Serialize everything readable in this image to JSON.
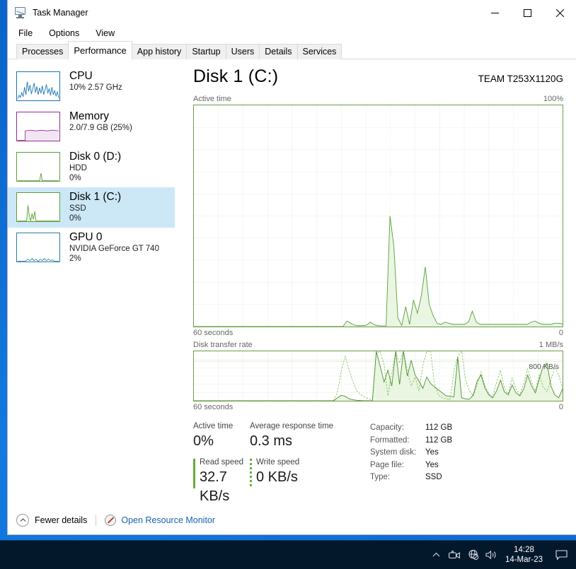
{
  "window": {
    "title": "Task Manager",
    "icon": "task-manager-icon",
    "controls": {
      "minimize": "─",
      "maximize": "□",
      "close": "✕"
    }
  },
  "menu": {
    "items": [
      "File",
      "Options",
      "View"
    ]
  },
  "tabs": {
    "items": [
      "Processes",
      "Performance",
      "App history",
      "Startup",
      "Users",
      "Details",
      "Services"
    ],
    "active": "Performance"
  },
  "sidebar": {
    "items": [
      {
        "title": "CPU",
        "sub1": "10%  2.57 GHz",
        "sub2": "",
        "color": "#1a74b0",
        "selected": false
      },
      {
        "title": "Memory",
        "sub1": "2.0/7.9 GB (25%)",
        "sub2": "",
        "color": "#8b2f8b",
        "selected": false
      },
      {
        "title": "Disk 0 (D:)",
        "sub1": "HDD",
        "sub2": "0%",
        "color": "#5a9e3a",
        "selected": false
      },
      {
        "title": "Disk 1 (C:)",
        "sub1": "SSD",
        "sub2": "0%",
        "color": "#5a9e3a",
        "selected": true
      },
      {
        "title": "GPU 0",
        "sub1": "NVIDIA GeForce GT 740",
        "sub2": "2%",
        "color": "#2a7f9e",
        "selected": false
      }
    ]
  },
  "main": {
    "title": "Disk 1 (C:)",
    "model": "TEAM T253X1120G",
    "active_graph": {
      "label": "Active time",
      "max_label": "100%",
      "x_label": "60 seconds",
      "min_label": "0"
    },
    "transfer_graph": {
      "label": "Disk transfer rate",
      "max_label": "1 MB/s",
      "annotation": "800 KB/s",
      "x_label": "60 seconds",
      "min_label": "0"
    },
    "stats": {
      "active_time_label": "Active time",
      "active_time_value": "0%",
      "avg_response_label": "Average response time",
      "avg_response_value": "0.3 ms",
      "read_label": "Read speed",
      "read_value": "32.7 KB/s",
      "write_label": "Write speed",
      "write_value": "0 KB/s",
      "details": [
        {
          "key": "Capacity:",
          "value": "112 GB"
        },
        {
          "key": "Formatted:",
          "value": "112 GB"
        },
        {
          "key": "System disk:",
          "value": "Yes"
        },
        {
          "key": "Page file:",
          "value": "Yes"
        },
        {
          "key": "Type:",
          "value": "SSD"
        }
      ]
    }
  },
  "footer": {
    "fewer_details": "Fewer details",
    "resource_monitor": "Open Resource Monitor"
  },
  "taskbar": {
    "time": "14:28",
    "date": "14-Mar-23"
  },
  "colors": {
    "graph_line": "#5a9e3a",
    "graph_fill": "#eaf5e2",
    "accent_link": "#1763b0",
    "selection": "#cce8f7"
  },
  "chart_data": [
    {
      "type": "area",
      "title": "Active time",
      "ylabel": "Active time",
      "xlabel": "60 seconds",
      "ylim": [
        0,
        100
      ],
      "yunit": "%",
      "grid": true,
      "values": [
        0,
        0,
        0,
        0,
        0,
        0,
        0,
        0,
        0,
        0,
        0,
        0,
        0,
        0,
        0,
        0,
        0,
        0,
        0,
        0,
        0,
        0,
        0,
        0,
        0,
        0,
        0,
        0,
        0,
        0,
        0,
        0,
        0,
        0,
        0,
        0,
        0,
        0,
        0,
        2.5,
        1.5,
        0.6,
        0.4,
        0.4,
        0.6,
        2,
        0.8,
        0.4,
        0.3,
        0.3,
        50,
        36,
        4,
        0.5,
        9,
        1,
        12,
        6,
        14,
        27,
        10,
        5,
        1.5,
        1,
        2,
        1.5,
        1,
        1,
        1,
        1,
        2,
        7,
        2,
        1,
        1,
        1,
        1,
        1,
        1,
        1,
        1,
        1,
        1,
        1,
        1,
        1,
        2,
        2.5,
        1.5,
        1,
        1,
        1,
        1.5,
        1.5,
        1.2
      ]
    },
    {
      "type": "line",
      "title": "Disk transfer rate",
      "ylabel": "Disk transfer rate",
      "xlabel": "60 seconds",
      "ylim": [
        0,
        1000
      ],
      "yunit": "KB/s",
      "annotation": "800 KB/s",
      "annotation_value": 800,
      "grid": true,
      "series": [
        {
          "name": "Read speed",
          "style": "solid",
          "values": [
            0,
            0,
            0,
            0,
            0,
            0,
            0,
            0,
            0,
            0,
            0,
            0,
            0,
            0,
            0,
            0,
            0,
            0,
            0,
            0,
            0,
            0,
            0,
            0,
            0,
            0,
            0,
            0,
            0,
            0,
            0,
            0,
            0,
            0,
            0,
            0,
            0,
            60,
            110,
            90,
            40,
            20,
            10,
            5,
            0,
            0,
            0,
            1000,
            700,
            380,
            620,
            300,
            1000,
            330,
            1000,
            500,
            820,
            520,
            400,
            250,
            480,
            350,
            280,
            220,
            160,
            100,
            90,
            80,
            880,
            60,
            40,
            30,
            120,
            400,
            520,
            260,
            120,
            60,
            200,
            420,
            180,
            120,
            320,
            160,
            100,
            240,
            520,
            300,
            160,
            440,
            700,
            760,
            300,
            120,
            60,
            240
          ]
        },
        {
          "name": "Write speed",
          "style": "dashed",
          "values": [
            0,
            0,
            0,
            0,
            0,
            0,
            0,
            0,
            0,
            0,
            0,
            0,
            0,
            0,
            0,
            0,
            0,
            0,
            0,
            0,
            0,
            0,
            0,
            0,
            0,
            0,
            0,
            0,
            0,
            0,
            0,
            0,
            0,
            0,
            0,
            0,
            0,
            180,
            600,
            900,
            620,
            380,
            200,
            120,
            80,
            40,
            20,
            960,
            1000,
            740,
            100,
            560,
            1000,
            760,
            1000,
            620,
            300,
            480,
            200,
            720,
            1000,
            1000,
            340,
            120,
            60,
            40,
            20,
            600,
            900,
            1000,
            420,
            200,
            100,
            320,
            580,
            300,
            140,
            80,
            380,
            620,
            260,
            140,
            460,
            240,
            120,
            360,
            640,
            380,
            200,
            520,
            280,
            180,
            420,
            680,
            520,
            260
          ]
        }
      ]
    }
  ]
}
